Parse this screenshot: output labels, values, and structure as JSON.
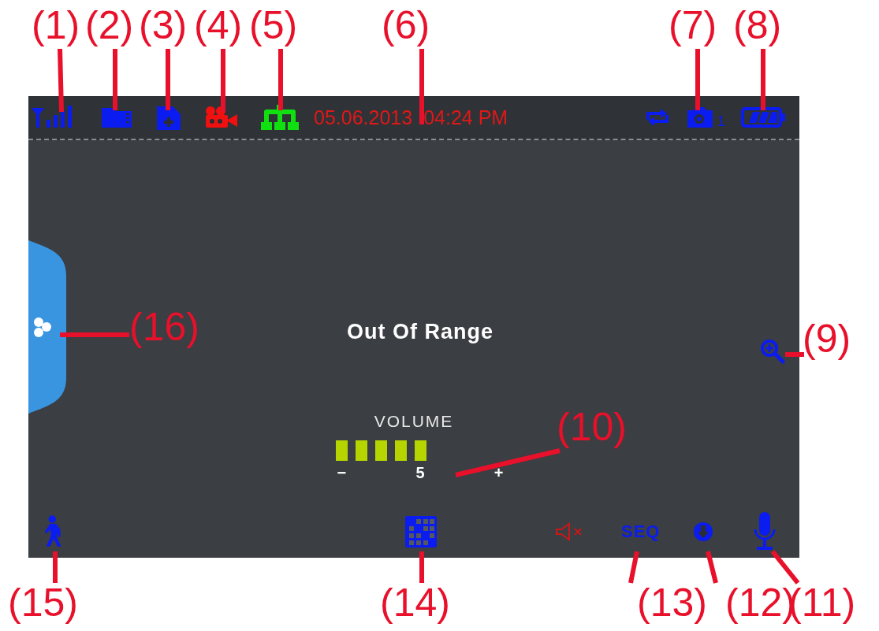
{
  "status_bar": {
    "date": "05.06.2013",
    "time": "04:24 PM",
    "camera_number": "1"
  },
  "message": "Out Of Range",
  "volume": {
    "label": "VOLUME",
    "minus": "−",
    "reading": "5",
    "plus": "+"
  },
  "bottom_bar": {
    "seq": "SEQ"
  },
  "callouts": [
    {
      "label": "(1)"
    },
    {
      "label": "(2)"
    },
    {
      "label": "(3)"
    },
    {
      "label": "(4)"
    },
    {
      "label": "(5)"
    },
    {
      "label": "(6)"
    },
    {
      "label": "(7)"
    },
    {
      "label": "(8)"
    },
    {
      "label": "(16)"
    },
    {
      "label": "(9)"
    },
    {
      "label": "(10)"
    },
    {
      "label": "(15)"
    },
    {
      "label": "(14)"
    },
    {
      "label": "(13)"
    },
    {
      "label": "(12)"
    },
    {
      "label": "(11)"
    }
  ]
}
